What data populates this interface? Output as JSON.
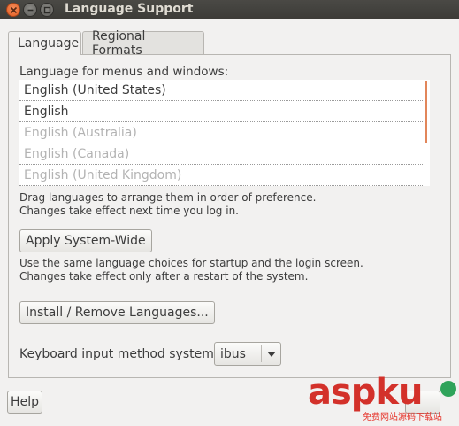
{
  "window": {
    "title": "Language Support"
  },
  "tabs": [
    {
      "label": "Language",
      "active": true
    },
    {
      "label": "Regional Formats",
      "active": false
    }
  ],
  "language": {
    "list_label": "Language for menus and windows:",
    "items": [
      {
        "label": "English (United States)",
        "enabled": true
      },
      {
        "label": "English",
        "enabled": true
      },
      {
        "label": "English (Australia)",
        "enabled": false
      },
      {
        "label": "English (Canada)",
        "enabled": false
      },
      {
        "label": "English (United Kingdom)",
        "enabled": false
      }
    ],
    "drag_hint_1": "Drag languages to arrange them in order of preference.",
    "drag_hint_2": "Changes take effect next time you log in.",
    "apply_button": "Apply System-Wide",
    "apply_hint_1": "Use the same language choices for startup and the login screen.",
    "apply_hint_2": "Changes take effect only after a restart of the system.",
    "install_button": "Install / Remove Languages...",
    "input_method_label": "Keyboard input method system:",
    "input_method_value": "ibus"
  },
  "footer": {
    "help_button": "Help"
  },
  "watermark": {
    "text": "aspku",
    "subtext": "免费网站源码下载站"
  },
  "colors": {
    "titlebar": "#3c3b37",
    "close_button": "#e05a1f",
    "scroll_indicator": "#e2865a",
    "watermark": "#d3312a"
  }
}
